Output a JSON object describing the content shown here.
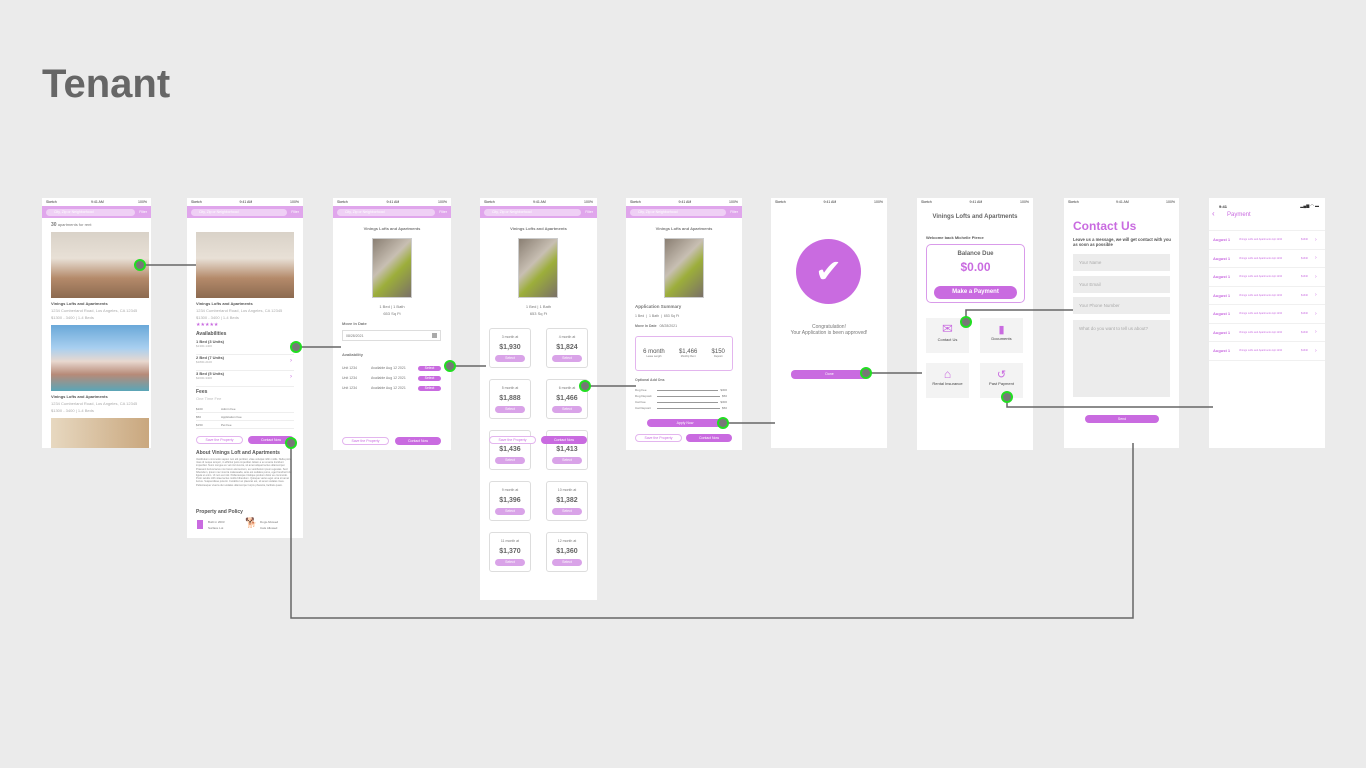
{
  "page_title": "Tenant",
  "status": {
    "carrier": "Sketch",
    "time": "9:41 AM",
    "battery": "100%"
  },
  "search": {
    "placeholder": "City, Zip or Neighborhood",
    "filter": "Filter"
  },
  "listing": {
    "name": "Vinings Lofts and Apartments",
    "address": "1234 Cumberland Road, Los Angeles, CA 12345",
    "price_beds": "$1300 - 3400  |  1-4 Beds",
    "count": "30",
    "count_label": "apartments for rent",
    "rating": 4.5
  },
  "detail": {
    "availabilities_title": "Availabilities",
    "availabilities": [
      {
        "beds": "1 Bed (3 Units)",
        "price": "$1300-1400"
      },
      {
        "beds": "2 Bed (7 Units)",
        "price": "$1800-2100"
      },
      {
        "beds": "3 Bed (5 Units)",
        "price": "$2000-3400"
      }
    ],
    "fees_title": "Fees",
    "fees_sub": "One Time Fee",
    "fees": [
      {
        "amount": "$100",
        "label": "Admin Fee"
      },
      {
        "amount": "$50",
        "label": "Application Fee"
      },
      {
        "amount": "$150",
        "label": "Pet Fee"
      }
    ],
    "about_title": "About Vinings Loft and Apartments",
    "about_text": "Vestibulum commodo sapien non elit porttitor, vitae volutpat nibh mollis. Nulla porta risus id neque tempor, in efficitur justo imperdiet. Etiam a ex at ante tincidunt imperdiet. Nunc congue ex vel nisl viverra, sit amet aliquet lectus ullamcorper. Praesent luctus lacus non lorem elementum, eu vestibulum ipsum egestas. Sed bibendum, ipsum nec viverra malesuada, ante est sodales purus, eget hendrerit dui ligula ut enim. Ut non est nisl. Pellentesque tristique pretium dolor eu commodo. Proin iaculis nibh vitae lectus mollis bibendum. Quisque varius eget urna sit amet luctus. Suspendisse potenti. Curabitur ac placerat est, sit amet sodales risus. Pellentesque viverra dui sodales ullamcorper turpis pharetra, facilisis quam.",
    "policy_title": "Property and Policy",
    "policy": [
      "Built in 2003",
      "Surface Lot",
      "Dogs Allowed",
      "Cats Allowed"
    ]
  },
  "buttons": {
    "save": "Save the Property",
    "contact": "Contact Now",
    "select": "Select",
    "apply": "Apply Now",
    "done": "Done",
    "send": "Send"
  },
  "unit": {
    "beds": "1 Bed",
    "bath": "1 Bath",
    "sqft": "653 Sq Ft",
    "move_in_label": "Move In Date",
    "move_in": "08/28/2021",
    "availability_title": "Availability",
    "units": [
      {
        "unit": "Unit 1234",
        "available": "Available Aug 12 2021"
      },
      {
        "unit": "Unit 1234",
        "available": "Available Aug 12 2021"
      },
      {
        "unit": "Unit 1234",
        "available": "Available Aug 12 2021"
      }
    ]
  },
  "leases": [
    {
      "term": "3 month at",
      "price": "$1,930"
    },
    {
      "term": "4 month at",
      "price": "$1,824"
    },
    {
      "term": "5 month at",
      "price": "$1,888"
    },
    {
      "term": "6 month at",
      "price": "$1,466"
    },
    {
      "term": "7 month at",
      "price": "$1,436"
    },
    {
      "term": "8 month at",
      "price": "$1,413"
    },
    {
      "term": "9 month at",
      "price": "$1,396"
    },
    {
      "term": "10 month at",
      "price": "$1,382"
    },
    {
      "term": "11 month at",
      "price": "$1,370"
    },
    {
      "term": "12 month at",
      "price": "$1,360"
    }
  ],
  "summary": {
    "title": "Application Summary",
    "lease": "6 month",
    "lease_label": "Lease Length",
    "rent": "$1,466",
    "rent_label": "Monthly Rent",
    "deposit": "$150",
    "deposit_label": "Deposit",
    "addons_title": "Optional Add Ons",
    "addons": [
      {
        "label": "Dog Fee",
        "amount": "$300"
      },
      {
        "label": "Dog Deposit",
        "amount": "$50"
      },
      {
        "label": "Cat Fee",
        "amount": "$300"
      },
      {
        "label": "Cat Deposit",
        "amount": "$50"
      }
    ]
  },
  "approved": {
    "line1": "Congratulation!",
    "line2": "Your Application is been approved!"
  },
  "dashboard": {
    "welcome": "Welcome back Michelle Pierce",
    "balance_label": "Balance Due",
    "balance": "$0.00",
    "pay": "Make a Payment",
    "tiles": [
      "Contact Us",
      "Documents",
      "Rental Insurance",
      "Past Payment"
    ]
  },
  "contact": {
    "title": "Contact Us",
    "subtitle": "Leave us a message, we will get contact with you as soon as possible",
    "name": "Your Name",
    "email": "Your Email",
    "phone": "Your Phone Number",
    "message": "What do you want to tell us about?"
  },
  "payments": {
    "time": "9:41",
    "title": "Payment",
    "rows": [
      {
        "date": "August 1",
        "desc": "Vinings Lofts and Apartments Apt 1234",
        "amount": "$1340"
      },
      {
        "date": "August 1",
        "desc": "Vinings Lofts and Apartments Apt 1234",
        "amount": "$1340"
      },
      {
        "date": "August 1",
        "desc": "Vinings Lofts and Apartments Apt 1234",
        "amount": "$1340"
      },
      {
        "date": "August 1",
        "desc": "Vinings Lofts and Apartments Apt 1234",
        "amount": "$1340"
      },
      {
        "date": "August 1",
        "desc": "Vinings Lofts and Apartments Apt 1234",
        "amount": "$1340"
      },
      {
        "date": "August 1",
        "desc": "Vinings Lofts and Apartments Apt 1234",
        "amount": "$1340"
      },
      {
        "date": "August 1",
        "desc": "Vinings Lofts and Apartments Apt 1234",
        "amount": "$1340"
      }
    ]
  },
  "colors": {
    "accent": "#c96be0",
    "accent_light": "#e0a6ec",
    "connector": "#666666",
    "hotspot": "#22dd22"
  }
}
